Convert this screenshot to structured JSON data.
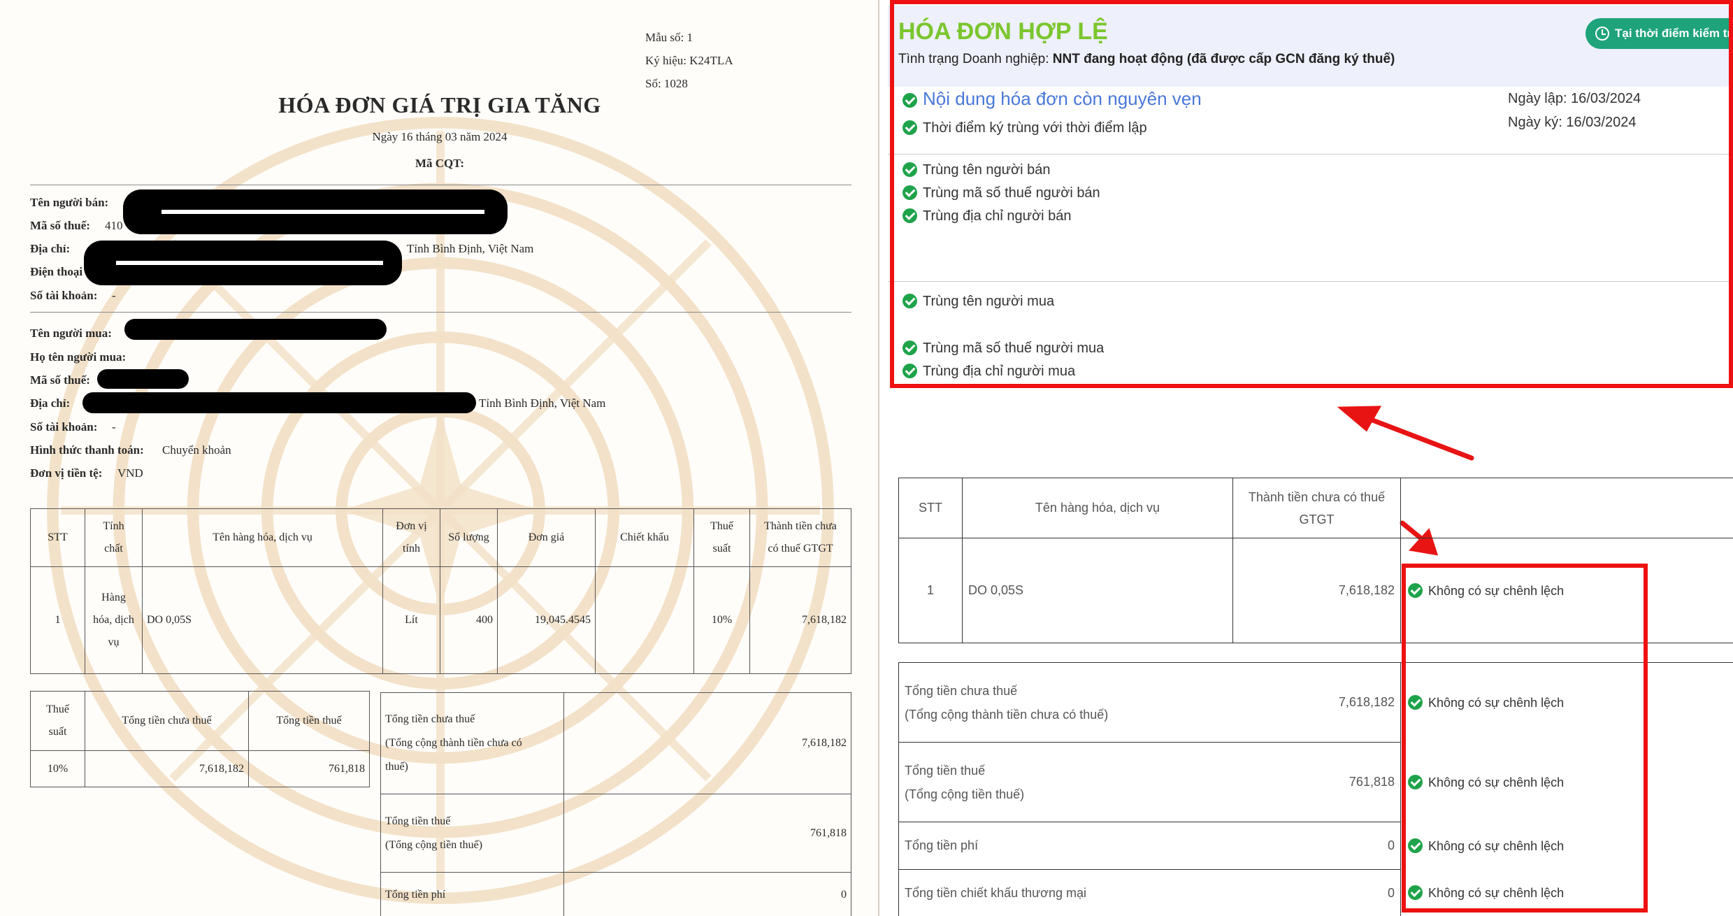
{
  "invoice": {
    "mau_so": "Mẫu số: 1",
    "ky_hieu": "Ký hiệu: K24TLA",
    "so": "Số: 1028",
    "title": "HÓA ĐƠN GIÁ TRỊ GIA TĂNG",
    "date": "Ngày 16 tháng 03 năm 2024",
    "ma_cqt": "Mã CQT:",
    "seller": {
      "name_label": "Tên người bán:",
      "tax_label": "Mã số thuế:",
      "tax_partial": "410",
      "address_label": "Địa chỉ:",
      "address_tail": "Tỉnh Bình Định, Việt Nam",
      "phone_label": "Điện thoại",
      "account_label": "Số tài khoản:",
      "account_value": "-"
    },
    "buyer": {
      "name_label": "Tên người mua:",
      "fullname_label": "Họ tên người mua:",
      "tax_label": "Mã số thuế:",
      "address_label": "Địa chỉ:",
      "address_tail": "Tỉnh Bình Định, Việt Nam",
      "account_label": "Số tài khoản:",
      "account_value": "-",
      "payment_label": "Hình thức thanh toán:",
      "payment_value": "Chuyển khoản",
      "currency_label": "Đơn vị tiền tệ:",
      "currency_value": "VND"
    },
    "items_headers": {
      "stt": "STT",
      "tinh_chat_1": "Tính",
      "tinh_chat_2": "chất",
      "ten_hang": "Tên hàng hóa, dịch vụ",
      "don_vi_1": "Đơn vị",
      "don_vi_2": "tính",
      "so_luong": "Số lượng",
      "don_gia": "Đơn giá",
      "chiet_khau": "Chiết khấu",
      "thue_1": "Thuế",
      "thue_2": "suất",
      "thanh_tien_1": "Thành tiền chưa",
      "thanh_tien_2": "có thuế GTGT"
    },
    "item": {
      "stt": "1",
      "tinh_chat_1": "Hàng",
      "tinh_chat_2": "hóa, dịch",
      "tinh_chat_3": "vụ",
      "ten": "DO 0,05S",
      "dvt": "Lít",
      "so_luong": "400",
      "don_gia": "19,045.4545",
      "chiet_khau": "",
      "thue_suat": "10%",
      "thanh_tien": "7,618,182"
    },
    "tax_summary": {
      "h_thue_1": "Thuế",
      "h_thue_2": "suất",
      "h_chua_thue": "Tổng tiền chưa thuế",
      "h_tien_thue": "Tổng tiền thuế",
      "thue_suat": "10%",
      "chua_thue": "7,618,182",
      "tien_thue": "761,818"
    },
    "totals": {
      "chua_thue_1": "Tổng tiền chưa thuế",
      "chua_thue_2": "(Tổng cộng thành tiền chưa có",
      "chua_thue_3": "thuế)",
      "chua_thue_value": "7,618,182",
      "thue_1": "Tổng tiền thuế",
      "thue_2": "(Tổng cộng tiền thuế)",
      "thue_value": "761,818",
      "phi": "Tổng tiền phí",
      "phi_value": "0"
    }
  },
  "panel": {
    "status_title": "HÓA ĐƠN HỢP LỆ",
    "check_time_button": "Tại thời điểm kiểm tra",
    "business_label": "Tình trạng Doanh nghiệp:",
    "business_value": "NNT đang hoạt động (đã được cấp GCN đăng ký thuế)",
    "content_intact": "Nội dung hóa đơn còn nguyên vẹn",
    "sign_time_match": "Thời điểm ký trùng với thời điểm lập",
    "ngay_lap": "Ngày lập: 16/03/2024",
    "ngay_ky": "Ngày ký: 16/03/2024",
    "seller_checks": [
      "Trùng tên người bán",
      "Trùng mã số thuế người bán",
      "Trùng địa chỉ người bán"
    ],
    "buyer_name_check": "Trùng tên người mua",
    "buyer_checks": [
      "Trùng mã số thuế người mua",
      "Trùng địa chỉ người mua"
    ],
    "table": {
      "h_stt": "STT",
      "h_ten": "Tên hàng hóa, dịch vụ",
      "h_thanh_tien_1": "Thành tiền chưa có thuế",
      "h_thanh_tien_2": "GTGT",
      "row_stt": "1",
      "row_ten": "DO 0,05S",
      "row_value": "7,618,182",
      "no_diff": "Không có sự chênh lệch",
      "sum_chua_thue_1": "Tổng tiền chưa thuế",
      "sum_chua_thue_2": "(Tổng cộng thành tiền chưa có thuế)",
      "sum_chua_thue_value": "7,618,182",
      "sum_thue_1": "Tổng tiền thuế",
      "sum_thue_2": "(Tổng cộng tiền thuế)",
      "sum_thue_value": "761,818",
      "sum_phi": "Tổng tiền phí",
      "sum_phi_value": "0",
      "sum_ck": "Tổng tiền chiết khấu thương mại",
      "sum_ck_value": "0"
    },
    "colors": {
      "valid_green": "#7bc62d",
      "accent_blue": "#4a78d8",
      "badge_green": "#1ea37a",
      "highlight_red": "#ee1111"
    }
  }
}
